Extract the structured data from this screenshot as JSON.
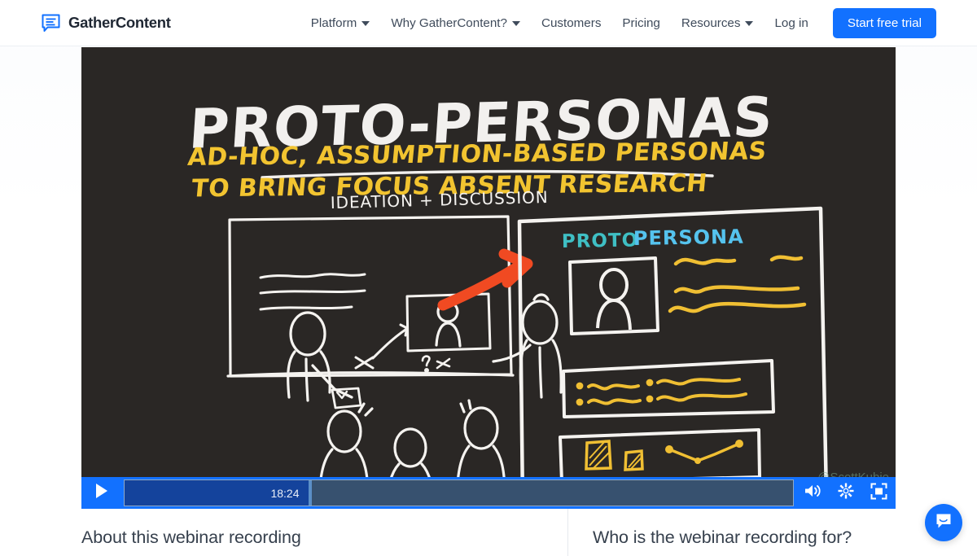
{
  "header": {
    "logo": {
      "icon": "gathercontent-document-bubble-icon",
      "text": "GatherContent"
    },
    "nav": [
      {
        "label": "Platform",
        "has_caret": true
      },
      {
        "label": "Why GatherContent?",
        "has_caret": true
      },
      {
        "label": "Customers",
        "has_caret": false
      },
      {
        "label": "Pricing",
        "has_caret": false
      },
      {
        "label": "Resources",
        "has_caret": true
      },
      {
        "label": "Log in",
        "has_caret": false
      }
    ],
    "cta_label": "Start free trial"
  },
  "video": {
    "title_line1": "PROTO-PERSONAS",
    "subtitle_line1": "AD-HOC, ASSUMPTION-BASED PERSONAS",
    "subtitle_line2": "TO BRING FOCUS ABSENT RESEARCH",
    "left_panel_label": "IDEATION + DISCUSSION",
    "right_panel_label_1": "PROTO",
    "right_panel_label_2": "PERSONA",
    "watermark": "@ScottKubie",
    "colors": {
      "background": "#2a2725",
      "title_white": "#f2f0ee",
      "subtitle_yellow": "#f2c430",
      "arrow_orange": "#f04a22",
      "persona_teal": "#3fbfc4",
      "persona_blue": "#55c3ee",
      "sketch_white": "#f5f3f0",
      "sketch_yellow": "#f0bf33"
    }
  },
  "player": {
    "play_icon": "play-icon",
    "current_time": "18:24",
    "progress_percent": 27.5,
    "volume_icon": "volume-icon",
    "settings_icon": "gear-icon",
    "fullscreen_icon": "fullscreen-icon",
    "accent_color": "#1271ff",
    "progress_fill_color": "#14439c",
    "progress_track_color": "#37516f"
  },
  "below_video": {
    "left_heading": "About this webinar recording",
    "right_heading": "Who is the webinar recording for?"
  },
  "chat_widget": {
    "icon": "chat-bubble-icon",
    "color": "#1271ff"
  }
}
